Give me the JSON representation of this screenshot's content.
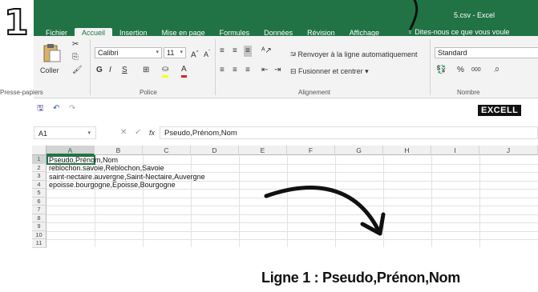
{
  "step_number": "1",
  "window": {
    "title": "5.csv - Excel"
  },
  "ribbon": {
    "tabs": [
      "Fichier",
      "Accueil",
      "Insertion",
      "Mise en page",
      "Formules",
      "Données",
      "Révision",
      "Affichage"
    ],
    "active_tab": "Accueil",
    "tell_me": "Dites-nous ce que vous voule",
    "clipboard": {
      "paste_label": "Coller",
      "group_label": "Presse-papiers"
    },
    "font": {
      "family": "Calibri",
      "size": "11",
      "group_label": "Police",
      "bold": "G",
      "italic": "I",
      "underline": "S"
    },
    "alignment": {
      "wrap_text": "Renvoyer à la ligne automatiquement",
      "merge": "Fusionner et centrer",
      "group_label": "Alignement"
    },
    "number": {
      "format": "Standard",
      "percent": "%",
      "thousands": "000",
      "group_label": "Nombre"
    }
  },
  "banner": "EXCELL",
  "formula_bar": {
    "name_box": "A1",
    "fx": "fx",
    "content": "Pseudo,Prénom,Nom"
  },
  "grid": {
    "columns": [
      "A",
      "B",
      "C",
      "D",
      "E",
      "F",
      "G",
      "H",
      "I",
      "J"
    ],
    "rows": [
      "1",
      "2",
      "3",
      "4",
      "5",
      "6",
      "7",
      "8",
      "9",
      "10",
      "11"
    ],
    "cells": [
      "Pseudo,Prénom,Nom",
      "reblochon.savoie,Reblochon,Savoie",
      "saint-nectaire.auvergne,Saint-Nectaire,Auvergne",
      "epoisse.bourgogne,Epoisse,Bourgogne"
    ],
    "selected_cell": "A1"
  },
  "annotation": "Ligne 1 : Pseudo,Prénon,Nom",
  "colors": {
    "accent": "#217346",
    "ribbon_bg": "#f3f3f3"
  }
}
